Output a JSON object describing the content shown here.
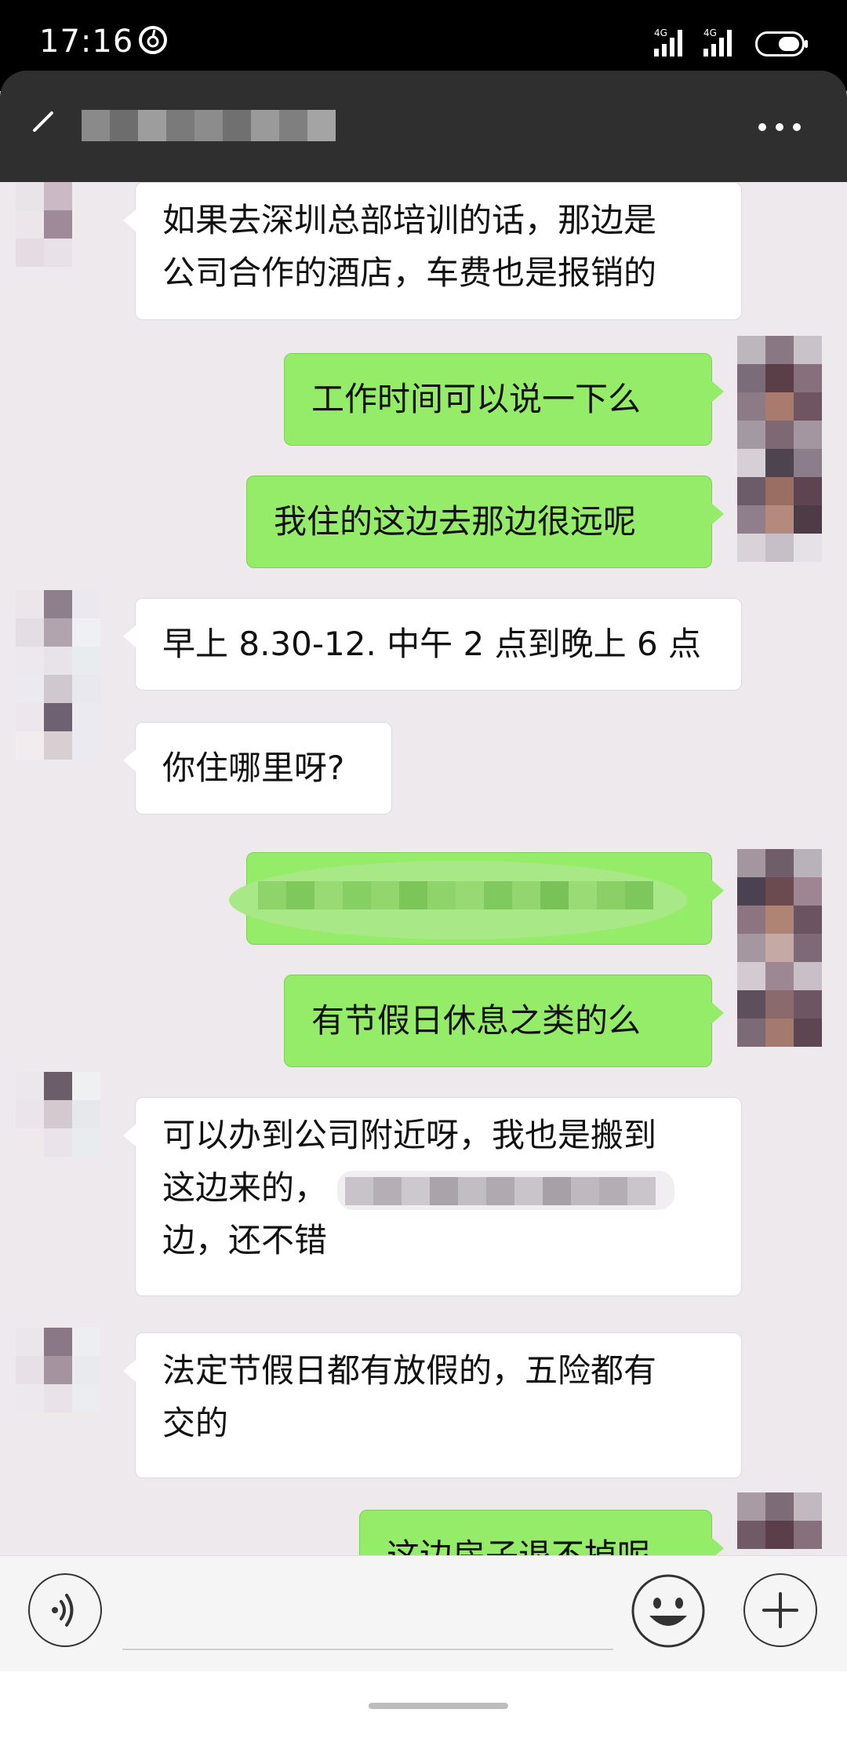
{
  "status_bar": {
    "time": "17:16",
    "signal_1_label": "4G",
    "signal_2_label": "4G"
  },
  "header": {
    "back_icon": "back-arrow-icon",
    "more_icon": "more-dots-icon"
  },
  "messages": [
    {
      "side": "in",
      "lines": [
        "如果去深圳总部培训的话，那边是",
        "公司合作的酒店，车费也是报销的"
      ]
    },
    {
      "side": "out",
      "lines": [
        "工作时间可以说一下么"
      ]
    },
    {
      "side": "out",
      "lines": [
        "我住的这边去那边很远呢"
      ]
    },
    {
      "side": "in",
      "lines": [
        "早上 8.30-12. 中午 2 点到晚上 6 点"
      ]
    },
    {
      "side": "in",
      "lines": [
        "你住哪里呀?"
      ]
    },
    {
      "side": "out",
      "lines": [
        ""
      ]
    },
    {
      "side": "out",
      "lines": [
        "有节假日休息之类的么"
      ]
    },
    {
      "side": "in",
      "lines": [
        "可以办到公司附近呀，我也是搬到",
        "这边来的，",
        "边，还不错"
      ]
    },
    {
      "side": "in",
      "lines": [
        "法定节假日都有放假的，五险都有",
        "交的"
      ]
    },
    {
      "side": "out",
      "lines": [
        "这边房子退不掉呢"
      ]
    }
  ],
  "input_bar": {
    "voice_icon": "voice-icon",
    "emoji_icon": "emoji-icon",
    "plus_icon": "plus-icon",
    "text_value": ""
  },
  "colors": {
    "incoming_bubble": "#ffffff",
    "outgoing_bubble": "#95ec69",
    "chat_background": "#ede9ec",
    "header_background": "#2f2f2f"
  }
}
